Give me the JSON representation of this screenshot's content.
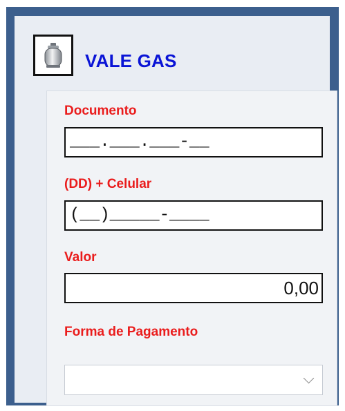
{
  "header": {
    "title": "VALE GAS",
    "logo_icon": "gas-cylinder-icon"
  },
  "form": {
    "documento": {
      "label": "Documento",
      "value": "___.___.___-__"
    },
    "celular": {
      "label": "(DD) + Celular",
      "value": "(__)_____-____"
    },
    "valor": {
      "label": "Valor",
      "value": "0,00"
    },
    "forma_pagamento": {
      "label": "Forma de Pagamento",
      "selected": ""
    }
  },
  "colors": {
    "title": "#0a14d6",
    "label": "#ea1c1c",
    "frame": "#3c5f8d",
    "panel": "#e9edf3"
  }
}
